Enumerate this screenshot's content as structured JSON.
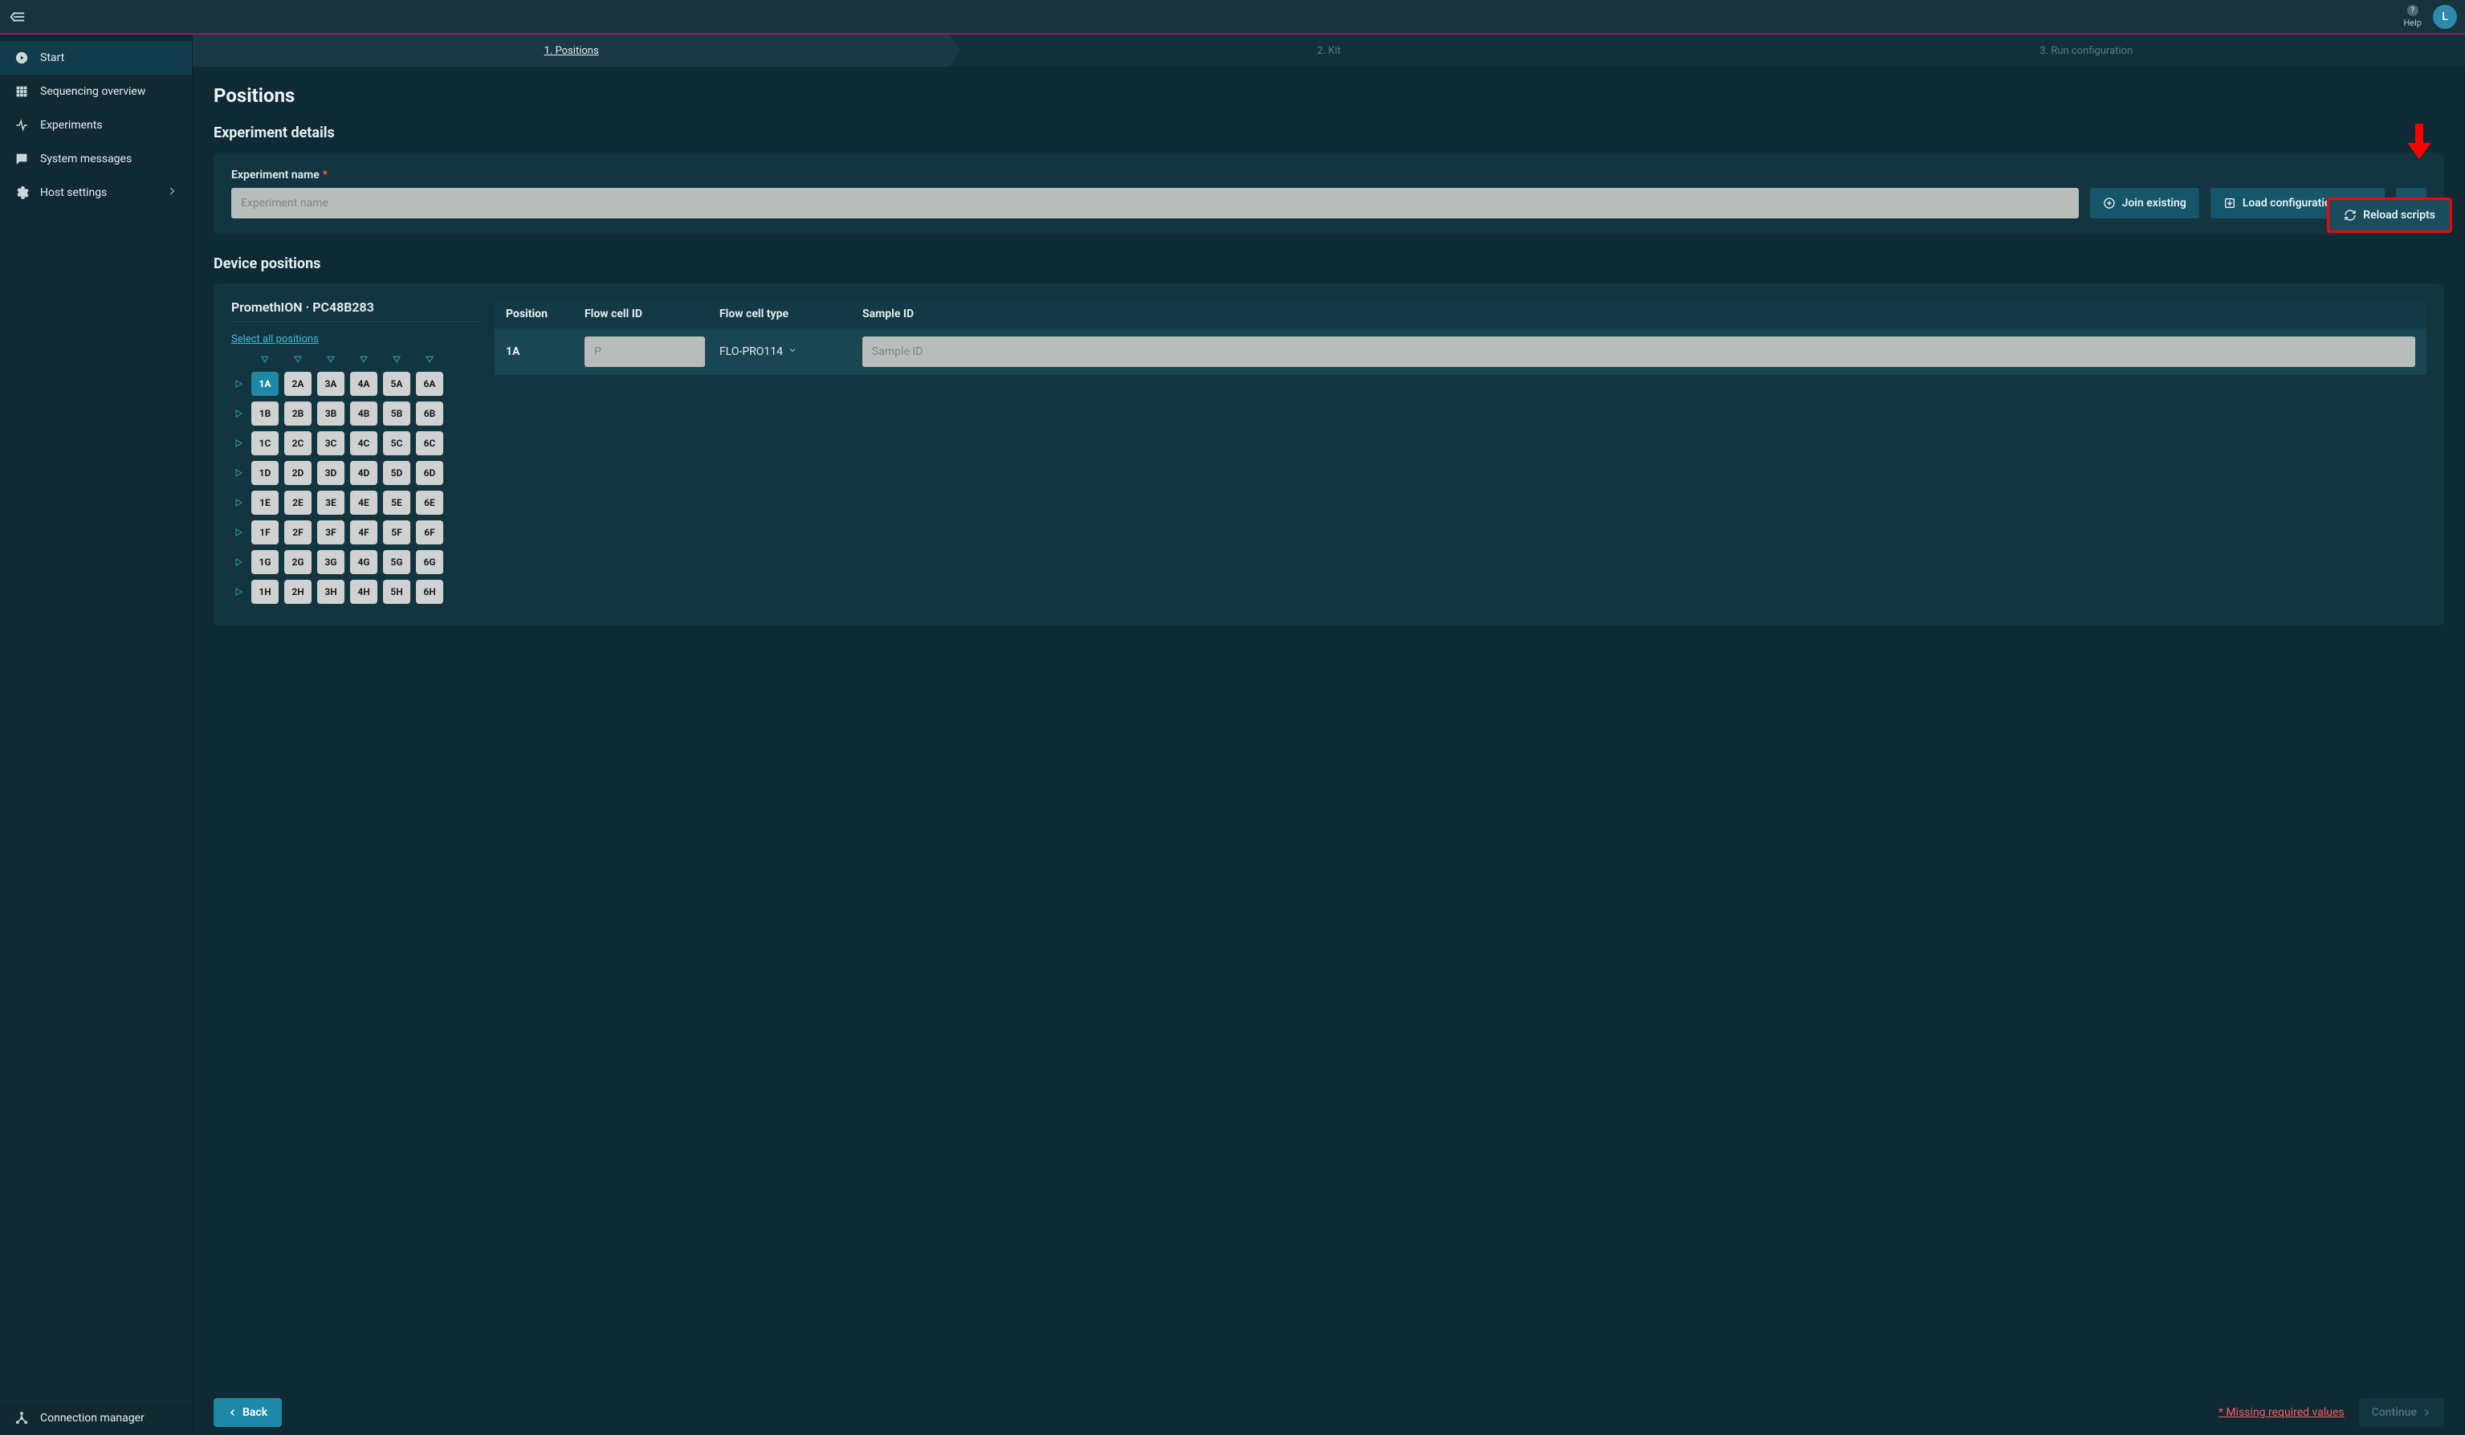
{
  "topbar": {
    "help_label": "Help",
    "avatar_initial": "L"
  },
  "sidebar": {
    "items": [
      {
        "label": "Start",
        "icon": "play-circle-icon",
        "active": true,
        "chevron": false
      },
      {
        "label": "Sequencing overview",
        "icon": "grid-icon",
        "active": false,
        "chevron": false
      },
      {
        "label": "Experiments",
        "icon": "activity-icon",
        "active": false,
        "chevron": false
      },
      {
        "label": "System messages",
        "icon": "message-icon",
        "active": false,
        "chevron": false
      },
      {
        "label": "Host settings",
        "icon": "gear-icon",
        "active": false,
        "chevron": true
      }
    ],
    "bottom": {
      "label": "Connection manager",
      "icon": "hub-icon"
    }
  },
  "steps": [
    {
      "label": "1. Positions",
      "active": true
    },
    {
      "label": "2. Kit",
      "active": false
    },
    {
      "label": "3. Run configuration",
      "active": false
    }
  ],
  "page": {
    "title": "Positions",
    "experiment_section": "Experiment details",
    "experiment_name_label": "Experiment name",
    "experiment_name_placeholder": "Experiment name",
    "join_existing": "Join existing",
    "load_preset": "Load configuration preset",
    "reload_scripts": "Reload scripts",
    "device_section": "Device positions",
    "device_name": "PromethION · PC48B283",
    "select_all": "Select all positions"
  },
  "grid": {
    "columns": [
      "1",
      "2",
      "3",
      "4",
      "5",
      "6"
    ],
    "rows": [
      "A",
      "B",
      "C",
      "D",
      "E",
      "F",
      "G",
      "H"
    ],
    "selected": "1A"
  },
  "table": {
    "headers": {
      "position": "Position",
      "flow_cell_id": "Flow cell ID",
      "flow_cell_type": "Flow cell type",
      "sample_id": "Sample ID"
    },
    "rows": [
      {
        "position": "1A",
        "flow_cell_id_placeholder": "P",
        "flow_cell_type": "FLO-PRO114",
        "sample_id_placeholder": "Sample ID"
      }
    ]
  },
  "footer": {
    "back": "Back",
    "missing": "* Missing required values",
    "continue": "Continue"
  }
}
